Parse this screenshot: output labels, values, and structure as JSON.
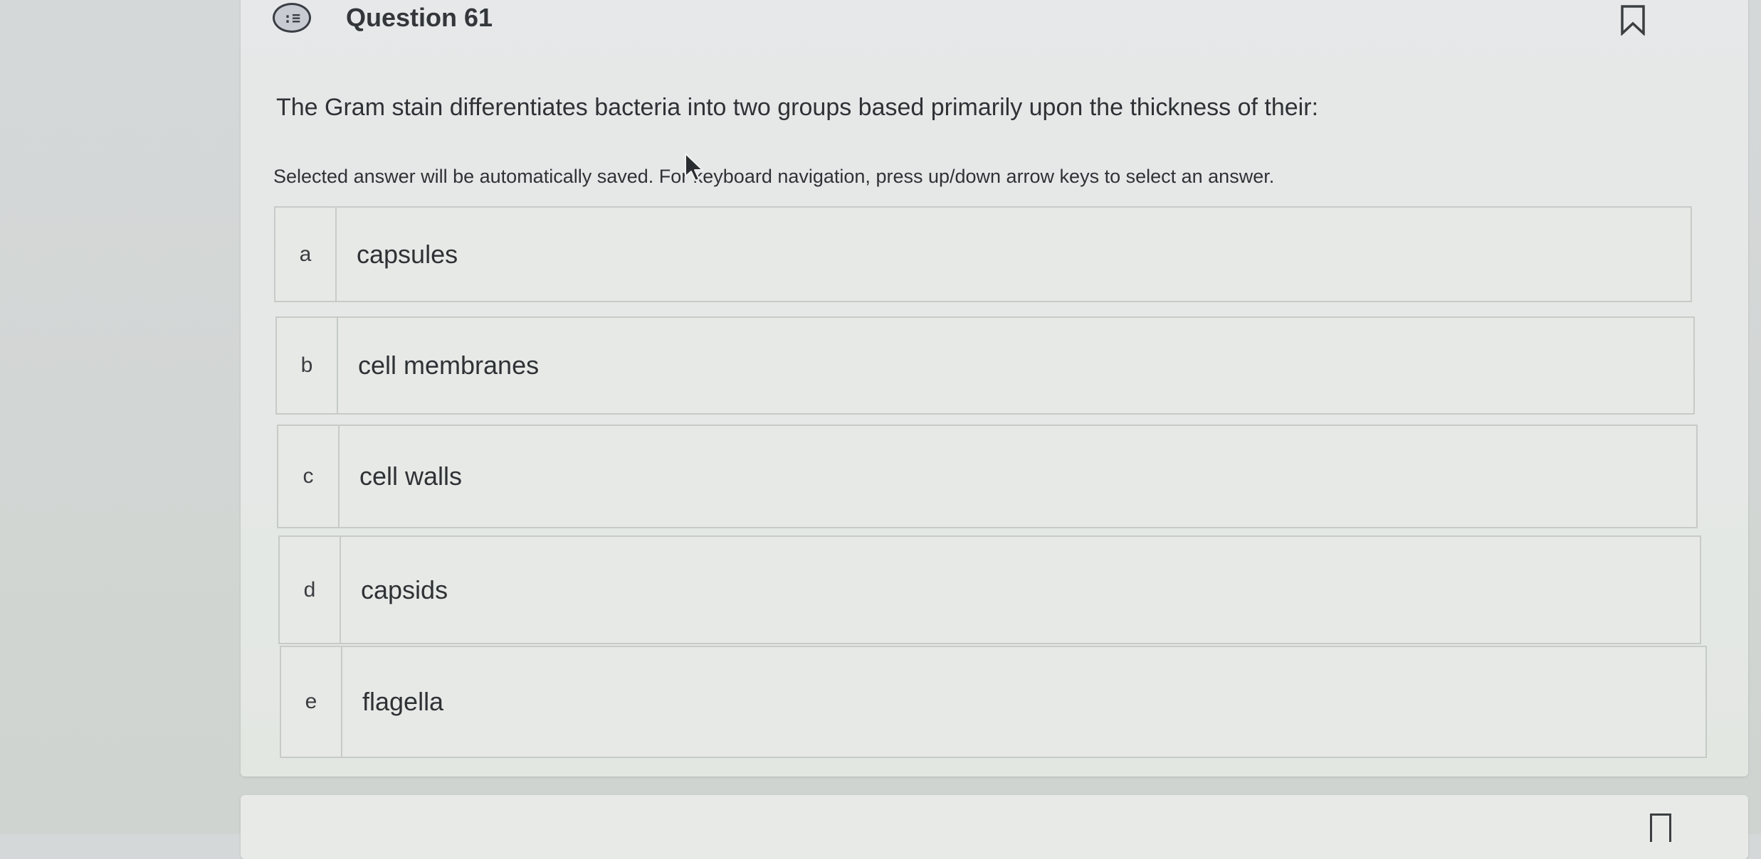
{
  "question": {
    "icon": "question-list-icon",
    "icon_glyph": ":≡",
    "title": "Question 61",
    "bookmark_icon": "bookmark-icon",
    "text": "The Gram stain differentiates bacteria into two groups based primarily upon the thickness of their:",
    "instructions": "Selected answer will be automatically saved. For keyboard navigation, press up/down arrow keys to select an answer."
  },
  "answers": [
    {
      "letter": "a",
      "label": "capsules"
    },
    {
      "letter": "b",
      "label": "cell membranes"
    },
    {
      "letter": "c",
      "label": "cell walls"
    },
    {
      "letter": "d",
      "label": "capsids"
    },
    {
      "letter": "e",
      "label": "flagella"
    }
  ],
  "colors": {
    "page_background": "#d3d7d5",
    "card_background": "#e6e9e6",
    "border": "#c7cbc8",
    "text": "#2f3235"
  }
}
